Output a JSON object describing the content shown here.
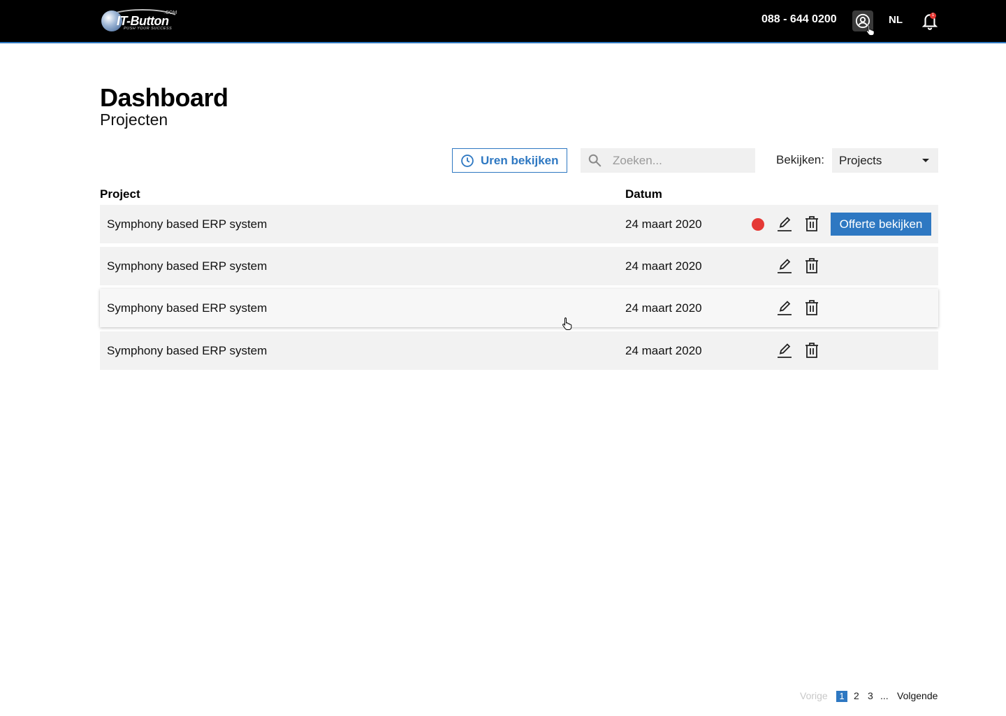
{
  "header": {
    "logo_text": "IT-Button",
    "logo_dotcom": ".COM",
    "logo_tagline": "PUSH YOUR SUCCESS",
    "phone": "088 - 644 0200",
    "language": "NL",
    "notification_count": "1"
  },
  "page": {
    "title": "Dashboard",
    "subtitle": "Projecten"
  },
  "toolbar": {
    "hours_button_label": "Uren bekijken",
    "search_placeholder": "Zoeken...",
    "view_label": "Bekijken:",
    "view_selected": "Projects"
  },
  "table": {
    "columns": {
      "project": "Project",
      "date": "Datum"
    },
    "rows": [
      {
        "name": "Symphony based ERP system",
        "date": "24 maart 2020",
        "has_alert": true,
        "offer_label": "Offerte bekijken"
      },
      {
        "name": "Symphony based ERP system",
        "date": "24 maart 2020",
        "has_alert": false
      },
      {
        "name": "Symphony based ERP system",
        "date": "24 maart 2020",
        "has_alert": false
      },
      {
        "name": "Symphony based ERP system",
        "date": "24 maart 2020",
        "has_alert": false
      }
    ]
  },
  "pagination": {
    "prev": "Vorige",
    "pages": [
      "1",
      "2",
      "3"
    ],
    "ellipsis": "...",
    "current": "1",
    "next": "Volgende"
  },
  "colors": {
    "accent": "#2e78c2",
    "alert": "#e53935",
    "header_bg": "#000000",
    "row_bg": "#f2f2f2"
  },
  "icons": {
    "user": "user-circle-icon",
    "bell": "bell-icon",
    "clock": "clock-icon",
    "search": "search-icon",
    "edit": "pencil-icon",
    "delete": "trash-icon"
  }
}
